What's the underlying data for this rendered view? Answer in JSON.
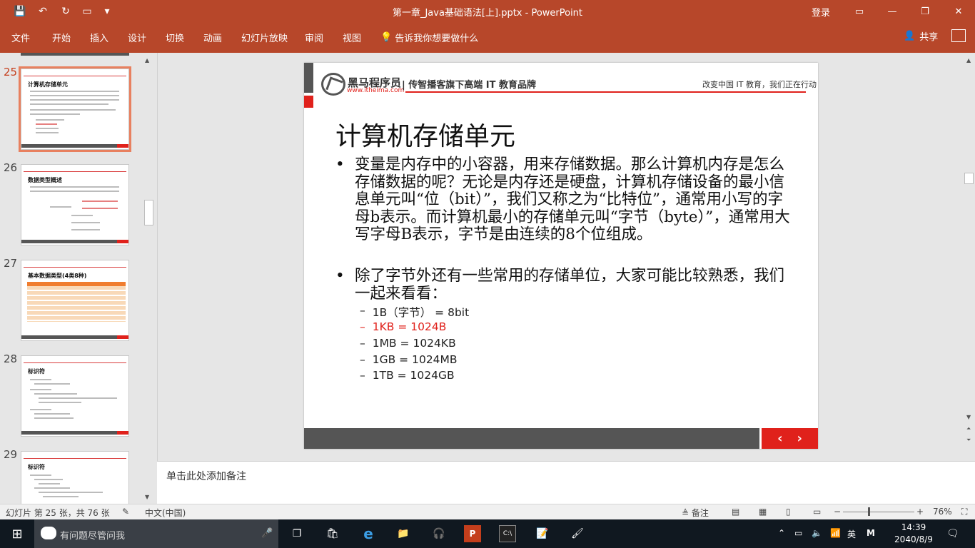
{
  "window": {
    "title": "第一章_Java基础语法[上].pptx  -  PowerPoint",
    "login": "登录",
    "minimize": "—",
    "restore": "❐",
    "close": "✕"
  },
  "quick_access": [
    "💾",
    "↶",
    "↻",
    "▭",
    "▾"
  ],
  "ribbon": {
    "file": "文件",
    "tabs": [
      "开始",
      "插入",
      "设计",
      "切换",
      "动画",
      "幻灯片放映",
      "审阅",
      "视图"
    ],
    "tellme": "告诉我你想要做什么",
    "share": "共享"
  },
  "thumbnails": [
    {
      "num": "25",
      "title": "计算机存储单元",
      "active": true
    },
    {
      "num": "26",
      "title": "数据类型概述",
      "active": false
    },
    {
      "num": "27",
      "title": "基本数据类型(4类8种)",
      "active": false
    },
    {
      "num": "28",
      "title": "标识符",
      "active": false
    },
    {
      "num": "29",
      "title": "标识符",
      "active": false
    }
  ],
  "slide": {
    "brand": "黑马程序员",
    "site": "www.itheima.com",
    "slogan": "| 传智播客旗下高端 IT 教育品牌",
    "motto": "改变中国 IT 教育，我们正在行动",
    "title": "计算机存储单元",
    "bullets": [
      "变量是内存中的小容器，用来存储数据。那么计算机内存是怎么存储数据的呢？无论是内存还是硬盘，计算机存储设备的最小信息单元叫“位（bit）”，我们又称之为“比特位”，通常用小写的字母b表示。而计算机最小的存储单元叫“字节（byte）”，通常用大写字母B表示，字节是由连续的8个位组成。",
      "除了字节外还有一些常用的存储单位，大家可能比较熟悉，我们一起来看看："
    ],
    "sub_items": [
      {
        "text": "1B（字节） = 8bit",
        "red": false
      },
      {
        "text": "1KB = 1024B",
        "red": true
      },
      {
        "text": "1MB = 1024KB",
        "red": false
      },
      {
        "text": "1GB = 1024MB",
        "red": false
      },
      {
        "text": "1TB = 1024GB",
        "red": false
      }
    ],
    "prev": "‹",
    "next": "›"
  },
  "notes": {
    "placeholder": "单击此处添加备注"
  },
  "status": {
    "slide_info": "幻灯片 第 25 张，共 76 张",
    "language": "中文(中国)",
    "notes_btn": "备注",
    "zoom": "76%"
  },
  "taskbar": {
    "search_placeholder": "有问题尽管问我",
    "ime": "英",
    "time": "14:39",
    "date": "2040/8/9"
  },
  "colors": {
    "accent": "#b7472a",
    "red": "#e0211b"
  }
}
